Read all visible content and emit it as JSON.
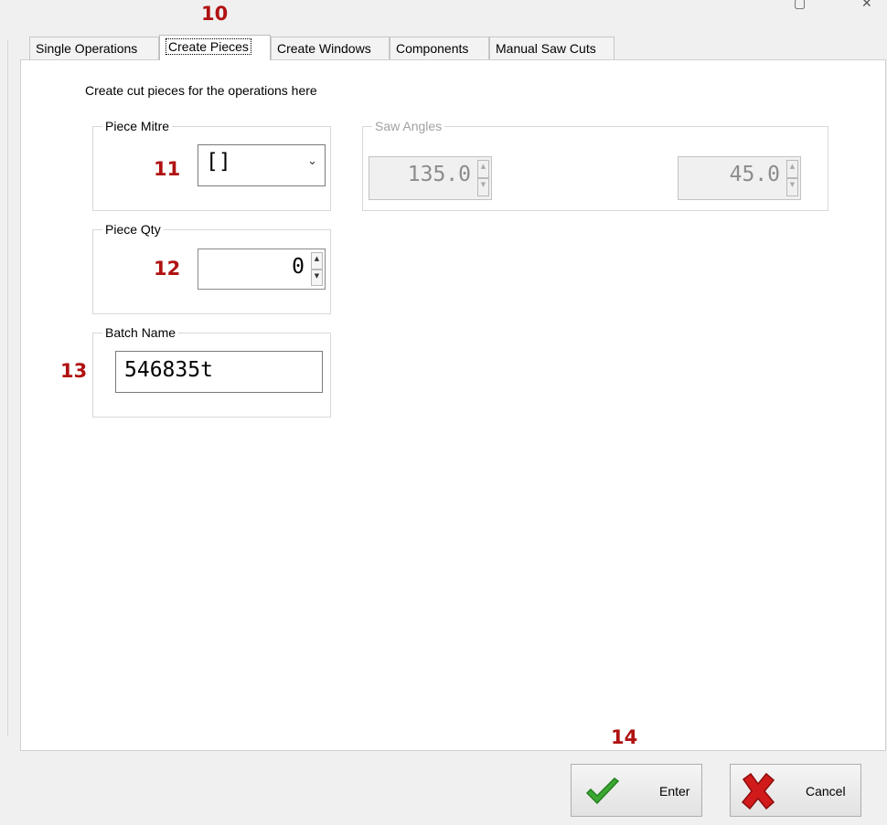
{
  "annotations": {
    "tab_marker": "10",
    "piece_mitre_marker": "11",
    "piece_qty_marker": "12",
    "batch_name_marker": "13",
    "enter_marker": "14"
  },
  "tabs": [
    {
      "label": "Single Operations"
    },
    {
      "label": "Create Pieces",
      "active": true
    },
    {
      "label": "Create Windows"
    },
    {
      "label": "Components"
    },
    {
      "label": "Manual Saw Cuts"
    }
  ],
  "instruction": "Create cut pieces for the operations here",
  "piece_mitre": {
    "legend": "Piece Mitre",
    "value": "[]"
  },
  "saw_angles": {
    "legend": "Saw Angles",
    "left_value": "135.0",
    "right_value": "45.0",
    "enabled": false
  },
  "piece_qty": {
    "legend": "Piece Qty",
    "value": "0"
  },
  "batch_name": {
    "legend": "Batch Name",
    "value": "546835t"
  },
  "buttons": {
    "enter_label": "Enter",
    "cancel_label": "Cancel"
  },
  "colors": {
    "annotation": "#b01212",
    "check_green": "#3aa832",
    "cancel_red": "#d11b1b"
  }
}
